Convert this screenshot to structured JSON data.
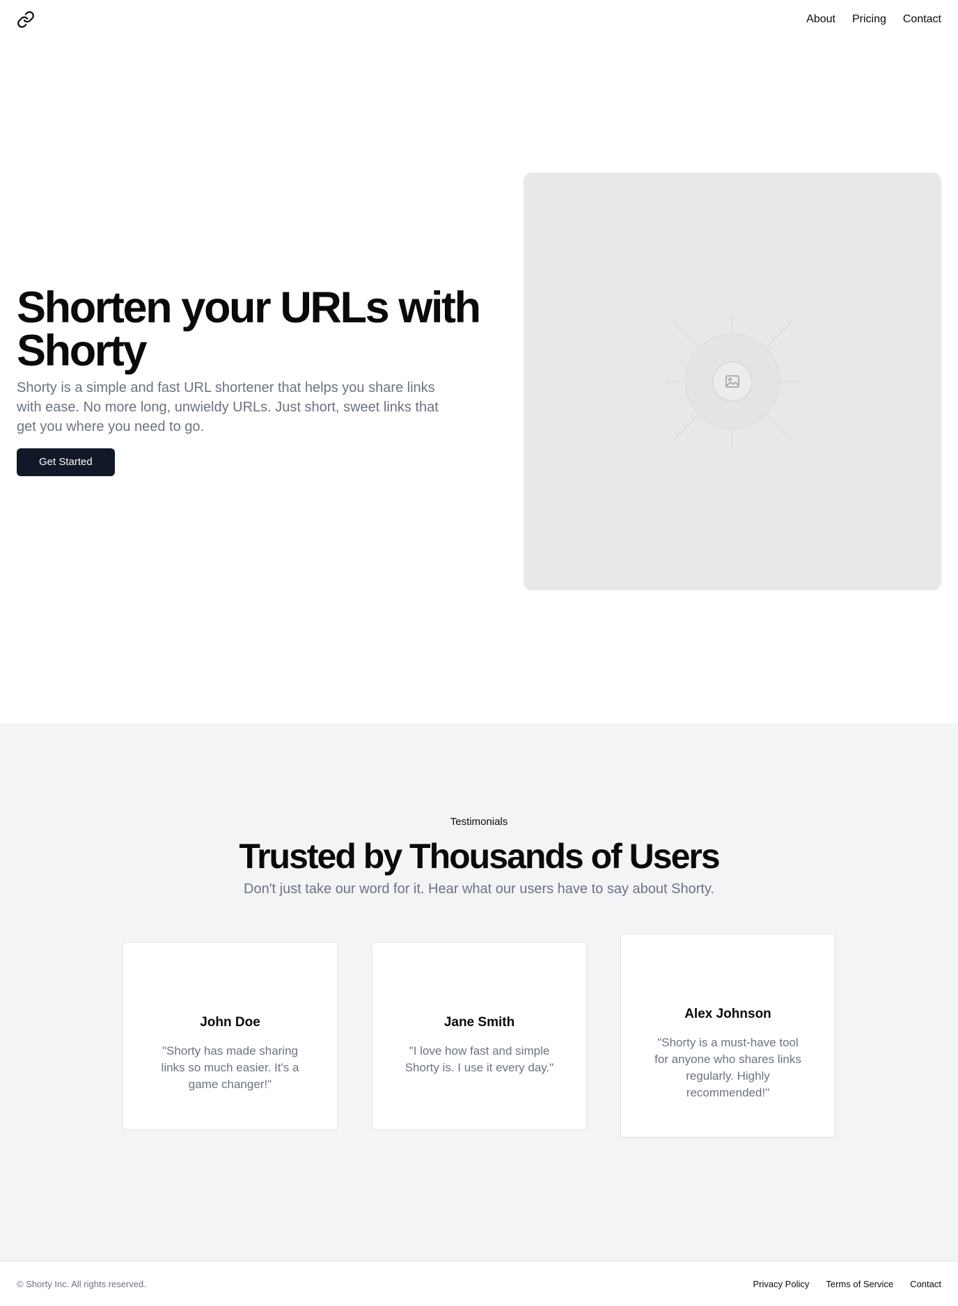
{
  "header": {
    "logo_icon": "link-icon",
    "nav": [
      "About",
      "Pricing",
      "Contact"
    ]
  },
  "hero": {
    "title_line1": "Shorten your URLs with",
    "title_line2": "Shorty",
    "description": "Shorty is a simple and fast URL shortener that helps you share links with ease. No more long, unwieldy URLs. Just short, sweet links that get you where you need to go.",
    "cta_label": "Get Started",
    "image_icon": "image-placeholder-icon"
  },
  "testimonials": {
    "eyebrow": "Testimonials",
    "title": "Trusted by Thousands of Users",
    "subtitle": "Don't just take our word for it. Hear what our users have to say about Shorty.",
    "items": [
      {
        "name": "John Doe",
        "quote": "\"Shorty has made sharing links so much easier. It's a game changer!\""
      },
      {
        "name": "Jane Smith",
        "quote": "\"I love how fast and simple Shorty is. I use it every day.\""
      },
      {
        "name": "Alex Johnson",
        "quote": "\"Shorty is a must-have tool for anyone who shares links regularly. Highly recommended!\""
      }
    ]
  },
  "footer": {
    "copyright": "© Shorty Inc. All rights reserved.",
    "links": [
      "Privacy Policy",
      "Terms of Service",
      "Contact"
    ]
  },
  "colors": {
    "button_bg": "#111827",
    "muted_text": "#6b7280",
    "section_bg": "#f3f4f6",
    "placeholder_bg": "#e8e8e8"
  }
}
